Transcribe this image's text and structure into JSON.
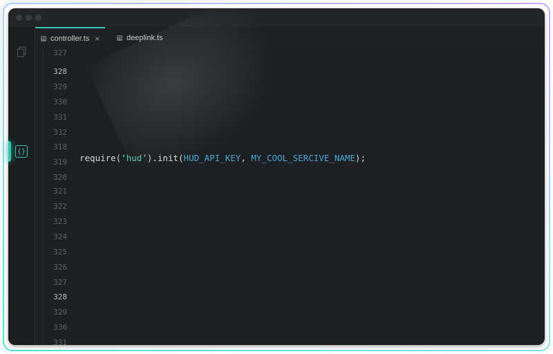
{
  "tabs": [
    {
      "label": "controller.ts",
      "icon": "typescript-file-icon",
      "active": true,
      "closable": true
    },
    {
      "label": "deeplink.ts",
      "icon": "typescript-file-icon",
      "active": false,
      "closable": false
    }
  ],
  "line_numbers": [
    "327",
    "328",
    "329",
    "330",
    "331",
    "332",
    "318",
    "319",
    "320",
    "321",
    "322",
    "323",
    "324",
    "325",
    "326",
    "327",
    "328",
    "329",
    "330",
    "331"
  ],
  "code_line": {
    "fn": "require(",
    "arg": "‘hud’",
    "mid": ").init(",
    "const1": "HUD_API_KEY",
    "sep": ", ",
    "const2": "MY_COOL_SERCIVE_NAME",
    "end": ");"
  },
  "marker_label": "{}",
  "colors": {
    "accent": "#2fc9ad",
    "string": "#57d0b6",
    "constant": "#4aa7d8"
  }
}
